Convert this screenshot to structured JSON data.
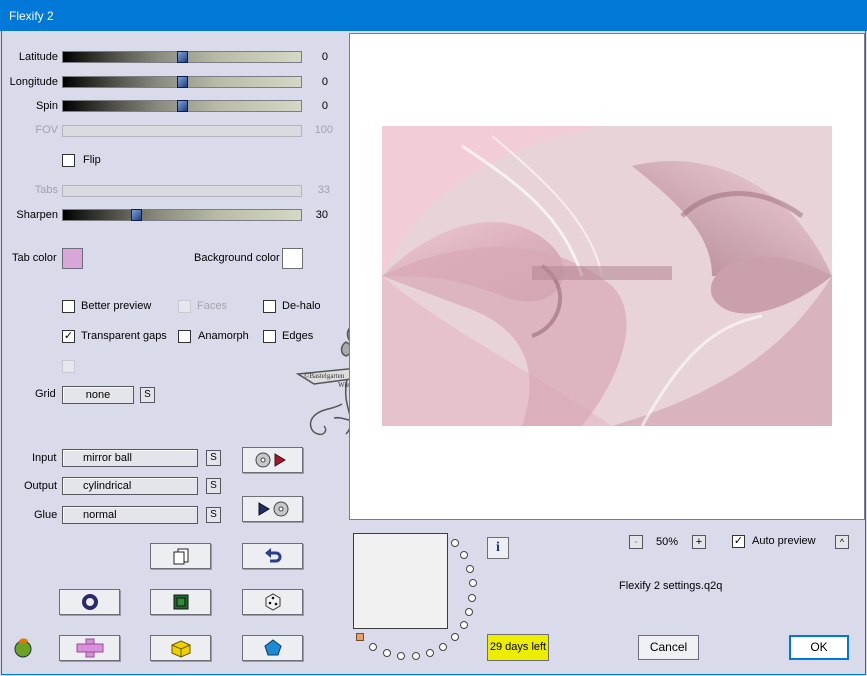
{
  "window": {
    "title": "Flexify 2"
  },
  "sliders": [
    {
      "label": "Latitude",
      "value": "0",
      "level": 0.5,
      "enabled": true
    },
    {
      "label": "Longitude",
      "value": "0",
      "level": 0.5,
      "enabled": true
    },
    {
      "label": "Spin",
      "value": "0",
      "level": 0.5,
      "enabled": true
    },
    {
      "label": "FOV",
      "value": "100",
      "enabled": false
    },
    {
      "label": "Tabs",
      "value": "33",
      "enabled": false
    },
    {
      "label": "Sharpen",
      "value": "30",
      "level": 0.3,
      "enabled": true
    }
  ],
  "flip": {
    "label": "Flip",
    "checked": false
  },
  "colors": {
    "tab_label": "Tab color",
    "tab_color": "#d9a6d9",
    "background_label": "Background color",
    "background_color": "#ffffff",
    "accent": "#0078d7"
  },
  "options": {
    "better_preview": "Better preview",
    "faces": "Faces",
    "de_halo": "De-halo",
    "transparent_gaps": "Transparent gaps",
    "anamorph": "Anamorph",
    "edges": "Edges"
  },
  "grid": {
    "label": "Grid",
    "value": "none"
  },
  "mapping": {
    "input_label": "Input",
    "input_value": "mirror ball",
    "output_label": "Output",
    "output_value": "cylindrical",
    "glue_label": "Glue",
    "glue_value": "normal"
  },
  "s_button": "S",
  "zoom": {
    "minus": "-",
    "value": "50%",
    "plus": "+"
  },
  "auto_preview": {
    "label": "Auto preview",
    "checked": true
  },
  "settings_file": "Flexify 2 settings.q2q",
  "trial": "29 days left",
  "buttons": {
    "cancel": "Cancel",
    "ok": "OK",
    "info": "i",
    "up": "^"
  },
  "watermark": {
    "text": "©Bastelgarten Wien"
  }
}
